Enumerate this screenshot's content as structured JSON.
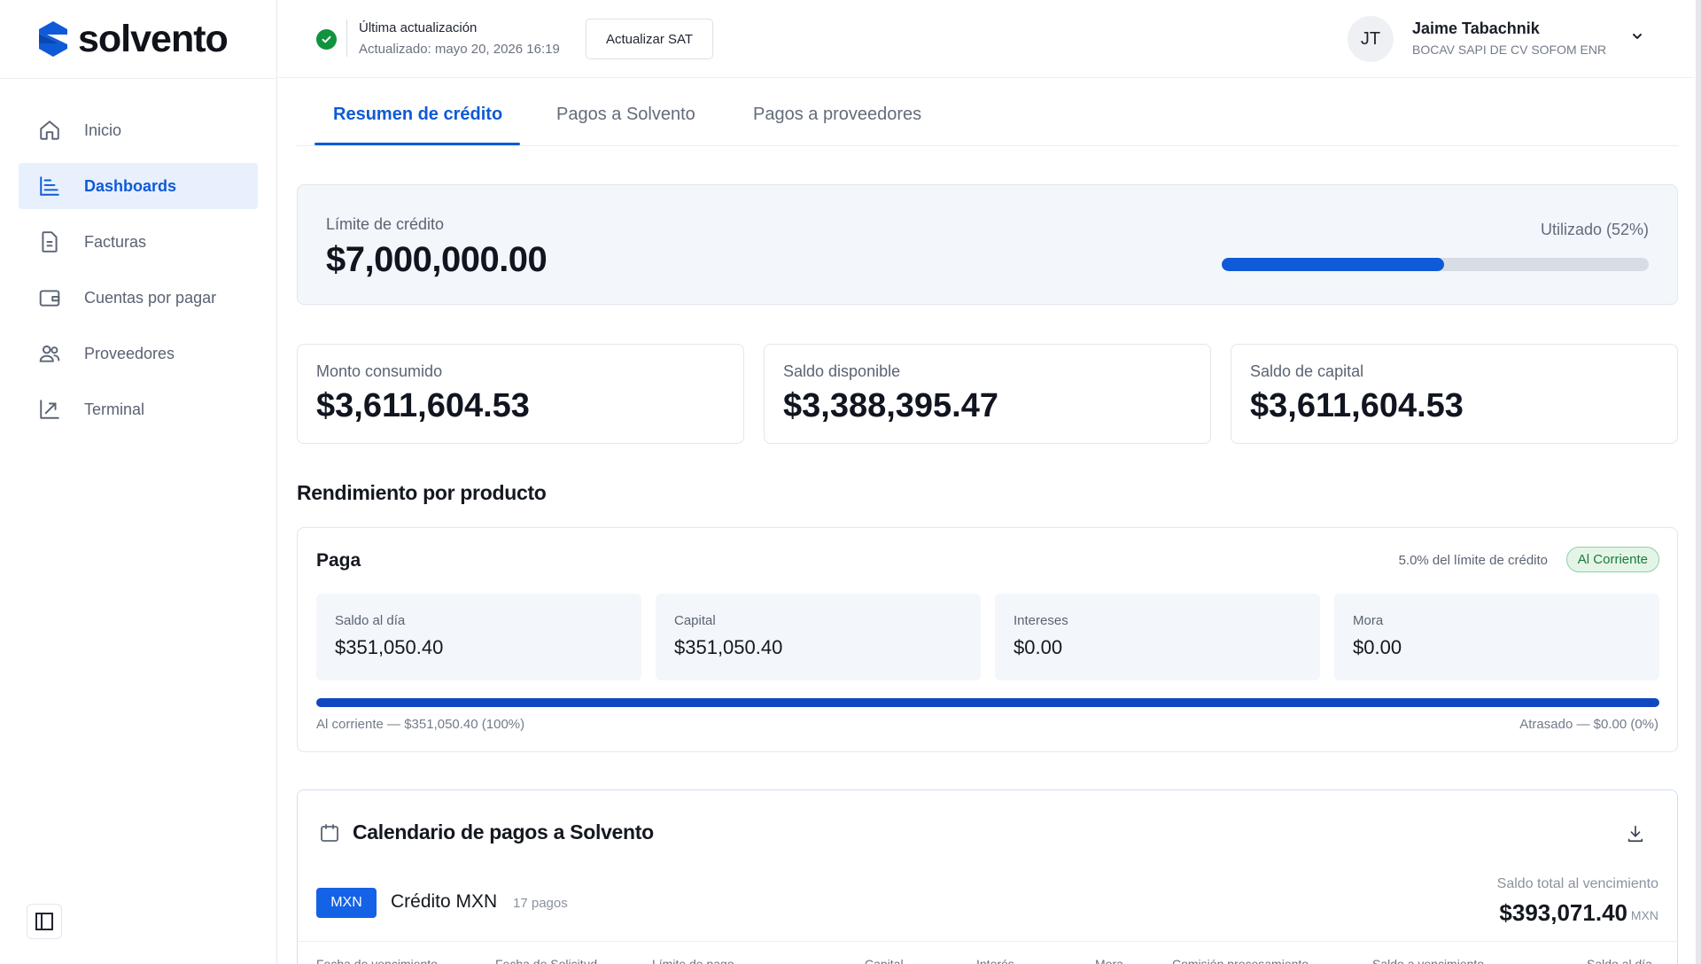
{
  "brand": {
    "name": "solvento",
    "color": "#0f5ad6"
  },
  "sidebar": {
    "items": [
      {
        "label": "Inicio",
        "icon": "home-icon",
        "active": false
      },
      {
        "label": "Dashboards",
        "icon": "bar-chart-icon",
        "active": true
      },
      {
        "label": "Facturas",
        "icon": "document-icon",
        "active": false
      },
      {
        "label": "Cuentas por pagar",
        "icon": "wallet-icon",
        "active": false
      },
      {
        "label": "Proveedores",
        "icon": "users-icon",
        "active": false
      },
      {
        "label": "Terminal",
        "icon": "terminal-icon",
        "active": false
      }
    ],
    "collapse_icon": "sidebar-toggle-icon"
  },
  "header": {
    "update_title": "Última actualización",
    "update_sub": "Actualizado: mayo 20, 2026 16:19",
    "sat_button": "Actualizar SAT",
    "user": {
      "initials": "JT",
      "name": "Jaime Tabachnik",
      "org": "BOCAV SAPI DE CV SOFOM ENR"
    }
  },
  "tabs": [
    {
      "label": "Resumen de crédito",
      "active": true
    },
    {
      "label": "Pagos a Solvento",
      "active": false
    },
    {
      "label": "Pagos a proveedores",
      "active": false
    }
  ],
  "limit": {
    "label": "Límite de crédito",
    "value": "$7,000,000.00",
    "used_label": "Utilizado (52%)",
    "used_fraction": 0.52
  },
  "stats": [
    {
      "label": "Monto consumido",
      "value": "$3,611,604.53"
    },
    {
      "label": "Saldo disponible",
      "value": "$3,388,395.47"
    },
    {
      "label": "Saldo de capital",
      "value": "$3,611,604.53"
    }
  ],
  "performance": {
    "title": "Rendimiento por producto",
    "product": {
      "name": "Paga",
      "pct_text": "5.0% del límite de crédito",
      "status": "Al Corriente",
      "status_color": "#1b7a37",
      "metrics": [
        {
          "label": "Saldo al día",
          "value": "$351,050.40"
        },
        {
          "label": "Capital",
          "value": "$351,050.40"
        },
        {
          "label": "Intereses",
          "value": "$0.00"
        },
        {
          "label": "Mora",
          "value": "$0.00"
        }
      ],
      "current_fraction": 1.0,
      "bar_left": "Al corriente — $351,050.40 (100%)",
      "bar_right": "Atrasado — $0.00 (0%)"
    }
  },
  "calendar": {
    "title": "Calendario de pagos a Solvento",
    "currency_badge": "MXN",
    "credit_title": "Crédito MXN",
    "payments_count": "17 pagos",
    "total_label": "Saldo total al vencimiento",
    "total_value": "$393,071.40",
    "total_currency": "MXN",
    "columns": [
      "Fecha de vencimiento",
      "Fecha de Solicitud",
      "Límite de pago",
      "Capital",
      "Interés",
      "Mora",
      "Comisión procesamiento",
      "Saldo a vencimiento",
      "Saldo al día"
    ]
  }
}
